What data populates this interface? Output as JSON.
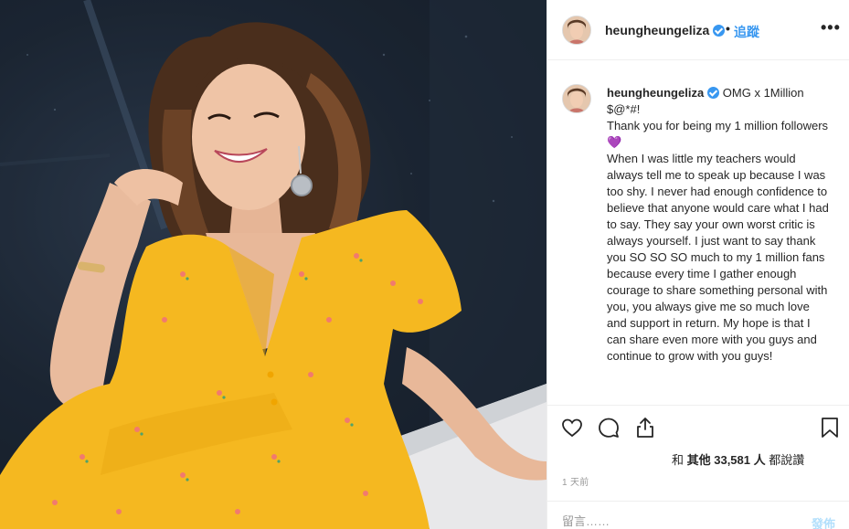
{
  "post": {
    "username": "heungheungeliza",
    "verified": true,
    "follow_label": "追蹤",
    "separator": "•",
    "more_label": "•••"
  },
  "caption": {
    "username": "heungheungeliza",
    "text": "OMG x 1Million\n$@*#!\nThank you for being my 1 million followers💜\nWhen I was little my teachers would always tell me to speak up because I was too shy. I never had enough confidence to believe that anyone would care what I had to say. They say your own worst critic is always yourself. I just want to say thank you SO SO SO much to my 1 million fans because every time I gather enough courage to share something personal with you, you always give me so much love and support in return. My hope is that I can share even more with you guys and continue to grow with you guys!"
  },
  "actions": {
    "like_icon": "heart-icon",
    "comment_icon": "comment-bubble-icon",
    "share_icon": "share-icon",
    "save_icon": "bookmark-icon"
  },
  "likes": {
    "prefix": "和 ",
    "bold_part": "其他 33,581 人",
    "suffix": " 都說讚"
  },
  "time_ago": "1 天前",
  "comment_box": {
    "placeholder": "留言……",
    "post_label": "發佈"
  },
  "colors": {
    "link_blue": "#3897f0",
    "verified_blue": "#3897f0",
    "post_disabled": "#b2dffc",
    "dress_yellow": "#f5b820"
  }
}
